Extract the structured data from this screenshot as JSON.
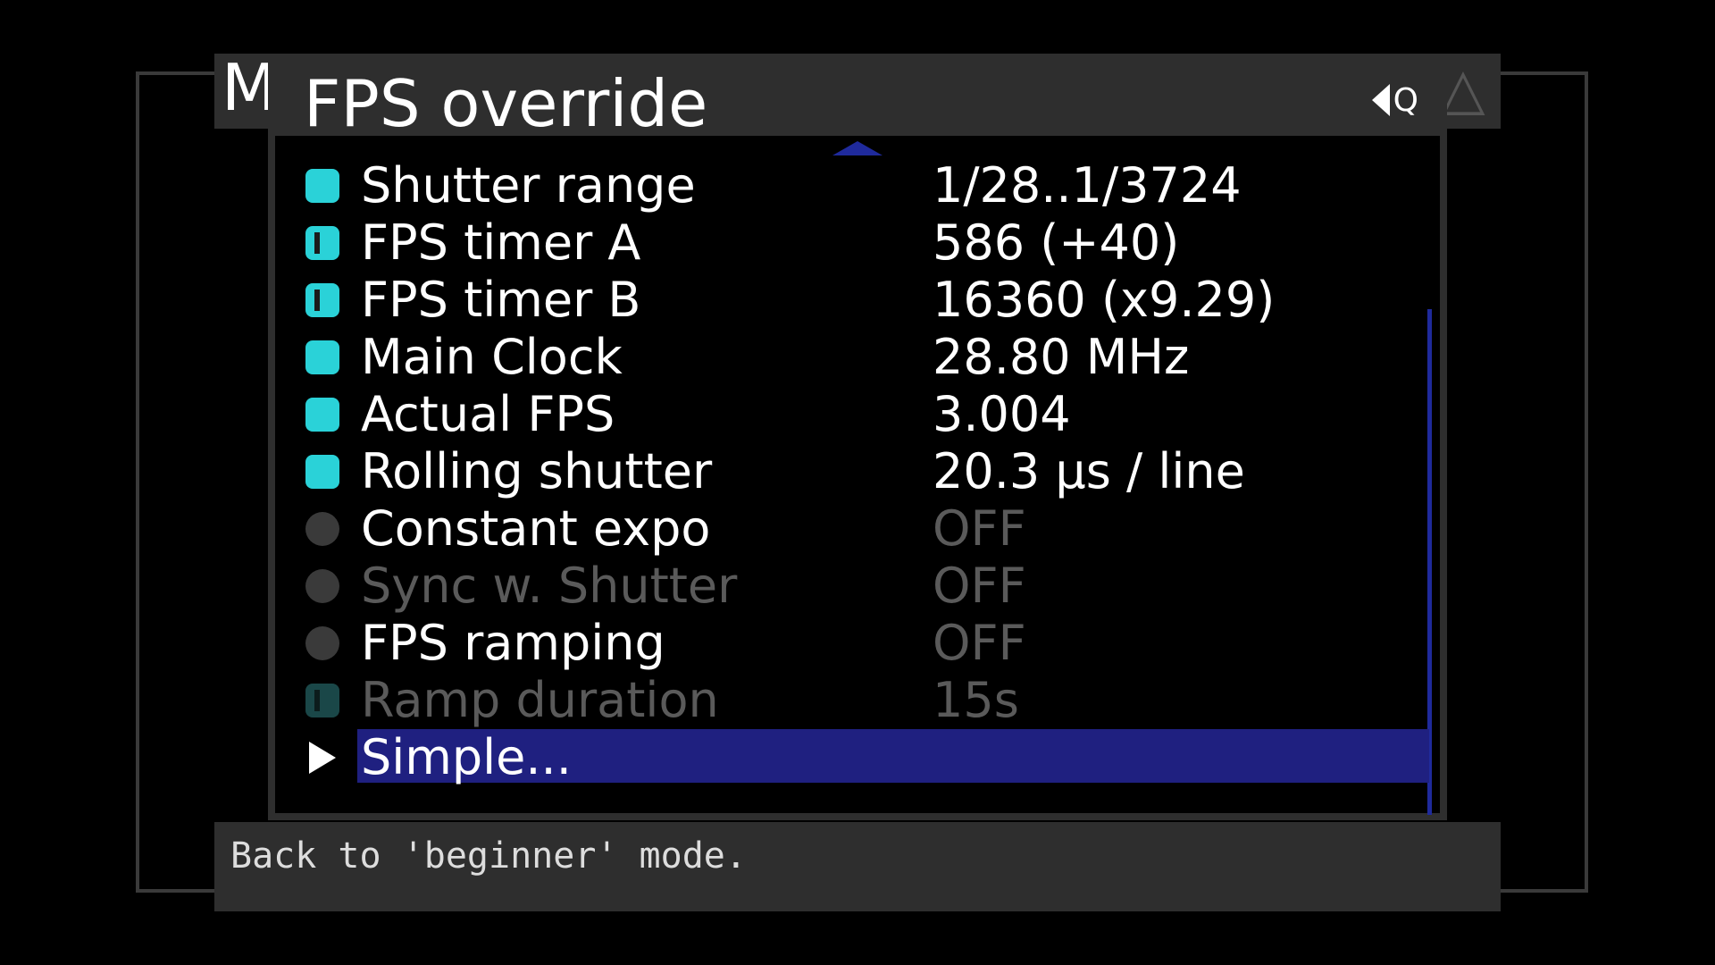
{
  "background": {
    "tab_left_letter": "M",
    "warn_icon": "warning-triangle-icon"
  },
  "dialog": {
    "title": "FPS override",
    "q_label": "Q",
    "q_icon": "back-triangle-icon"
  },
  "menu": {
    "items": [
      {
        "label": "Shutter range",
        "value": "1/28..1/3724",
        "icon": "square-icon",
        "state": "active"
      },
      {
        "label": "FPS timer A",
        "value": "586 (+40)",
        "icon": "square-bar-icon",
        "state": "active"
      },
      {
        "label": "FPS timer B",
        "value": "16360 (x9.29)",
        "icon": "square-bar-icon",
        "state": "active"
      },
      {
        "label": "Main Clock",
        "value": "28.80 MHz",
        "icon": "square-icon",
        "state": "active"
      },
      {
        "label": "Actual FPS",
        "value": "3.004",
        "icon": "square-icon",
        "state": "active"
      },
      {
        "label": "Rolling shutter",
        "value": "20.3 µs / line",
        "icon": "square-icon",
        "state": "active"
      },
      {
        "label": "Constant expo",
        "value": "OFF",
        "icon": "circle-icon",
        "state": "off"
      },
      {
        "label": "Sync w. Shutter",
        "value": "OFF",
        "icon": "circle-icon",
        "state": "disabled"
      },
      {
        "label": "FPS ramping",
        "value": "OFF",
        "icon": "circle-icon",
        "state": "off"
      },
      {
        "label": "Ramp duration",
        "value": "15s",
        "icon": "square-bar-icon",
        "state": "disabled"
      },
      {
        "label": "Simple...",
        "value": "",
        "icon": "submenu-arrow-icon",
        "state": "selected"
      }
    ]
  },
  "help": {
    "text": "Back to 'beginner' mode."
  },
  "colors": {
    "accent_cyan": "#2ad2d8",
    "selection_blue": "#1f2080",
    "scrollbar_blue": "#1f2a9c",
    "panel_gray": "#2e2e2e",
    "disabled_gray": "#5a5a5a"
  }
}
